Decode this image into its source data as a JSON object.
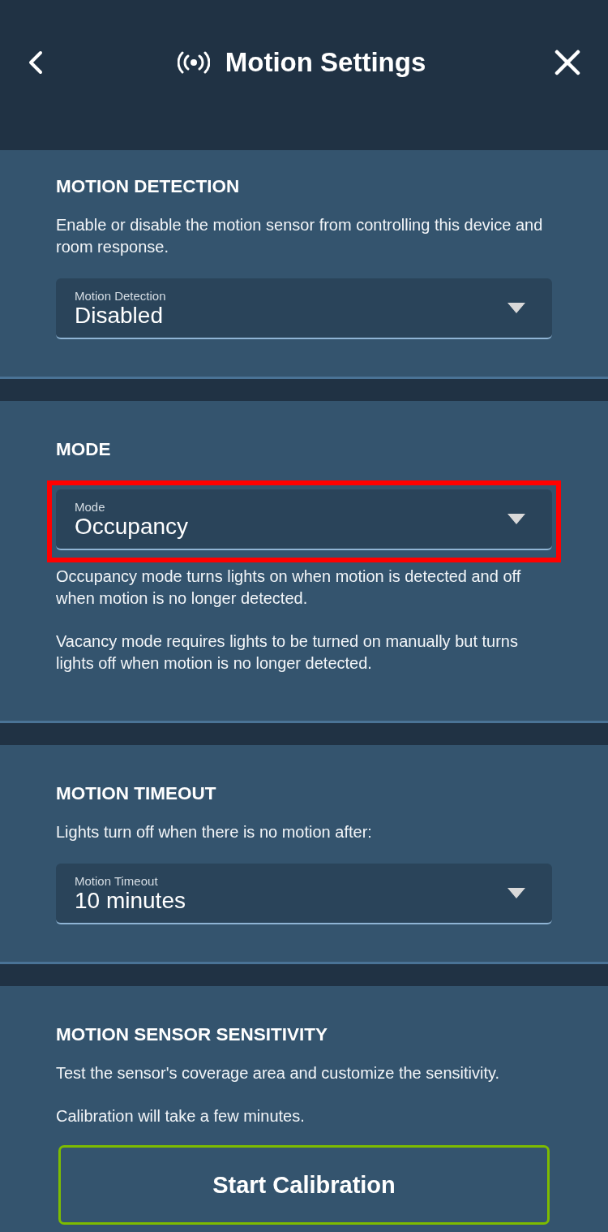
{
  "header": {
    "title": "Motion Settings"
  },
  "sections": [
    {
      "heading": "MOTION DETECTION",
      "blocks": [
        {
          "kind": "text",
          "text": "Enable or disable the motion sensor from controlling this device and room response."
        },
        {
          "kind": "dropdown",
          "label": "Motion Detection",
          "value": "Disabled",
          "highlighted": false
        }
      ]
    },
    {
      "heading": "MODE",
      "blocks": [
        {
          "kind": "dropdown",
          "label": "Mode",
          "value": "Occupancy",
          "highlighted": true
        },
        {
          "kind": "text",
          "text": "Occupancy mode turns lights on when motion is detected and off when motion is no longer detected."
        },
        {
          "kind": "text",
          "text": "Vacancy mode requires lights to be turned on manually but turns lights off when motion is no longer detected."
        }
      ]
    },
    {
      "heading": "MOTION TIMEOUT",
      "blocks": [
        {
          "kind": "text",
          "text": "Lights turn off when there is no motion after:"
        },
        {
          "kind": "dropdown",
          "label": "Motion Timeout",
          "value": "10 minutes",
          "highlighted": false
        }
      ]
    },
    {
      "heading": "MOTION SENSOR SENSITIVITY",
      "blocks": [
        {
          "kind": "text",
          "text": "Test the sensor's coverage area and customize the sensitivity."
        },
        {
          "kind": "text",
          "text": "Calibration will take a few minutes."
        },
        {
          "kind": "button",
          "label": "Start Calibration"
        }
      ]
    }
  ]
}
